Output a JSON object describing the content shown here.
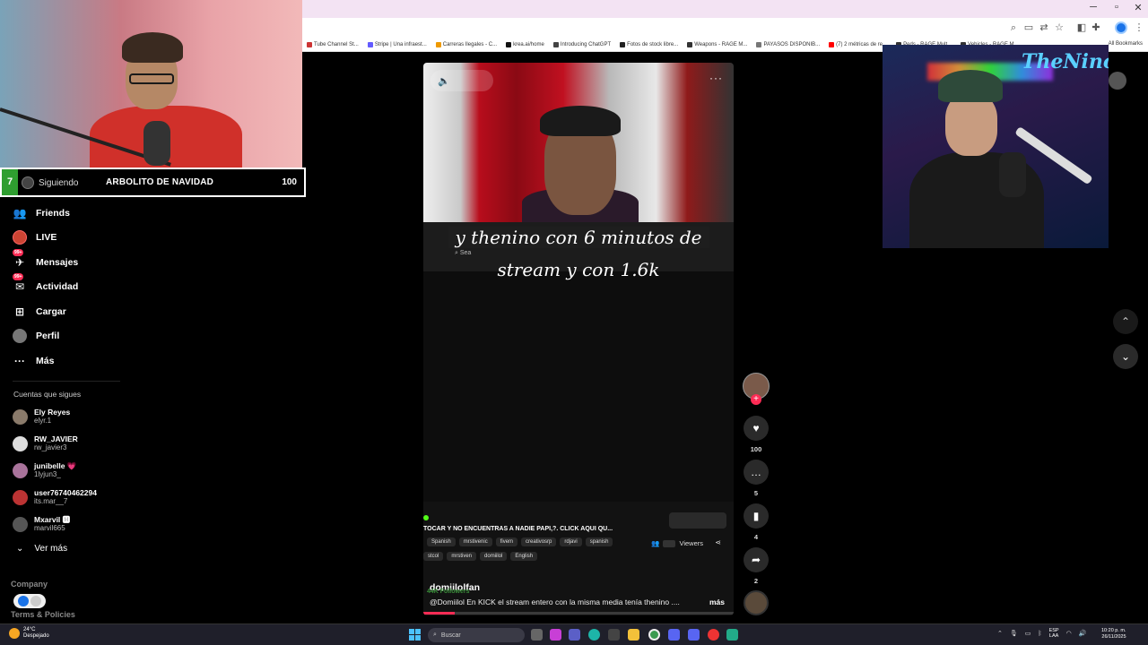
{
  "browser": {
    "bookmarks": [
      "Tube Channel St...",
      "Stripe | Una infraest...",
      "Carreras Ilegales - C...",
      "krea.ai/home",
      "Introducing ChatGPT",
      "Fotos de stock libre...",
      "Weapons - RAGE M...",
      "PAYASOS DISPONIB...",
      "(7) 2 métricas de re...",
      "Peds - RAGE Mult...",
      "Vehicles - RAGE M..."
    ],
    "all_bookmarks": "All Bookmarks"
  },
  "goal": {
    "count": "7",
    "following_label": "Siguiendo",
    "title": "ARBOLITO DE NAVIDAD",
    "number": "100"
  },
  "sidebar": {
    "items": [
      {
        "label": "Friends",
        "icon": "friends-icon"
      },
      {
        "label": "LIVE",
        "icon": "live-icon"
      },
      {
        "label": "Mensajes",
        "icon": "message-icon",
        "badge": "99+"
      },
      {
        "label": "Actividad",
        "icon": "activity-icon",
        "badge": "99+"
      },
      {
        "label": "Cargar",
        "icon": "upload-icon"
      },
      {
        "label": "Perfil",
        "icon": "profile-icon"
      },
      {
        "label": "Más",
        "icon": "more-icon"
      }
    ],
    "following_header": "Cuentas que sigues",
    "accounts": [
      {
        "name": "Ely Reyes",
        "user": "elyr.1"
      },
      {
        "name": "RW_JAVIER",
        "user": "rw_javier3"
      },
      {
        "name": "junibelle 💗",
        "user": "1lyjun3_"
      },
      {
        "name": "user76740462294",
        "user": "its.mar__7"
      },
      {
        "name": "Mxarvil 🅼",
        "user": "marvil665"
      }
    ],
    "see_more": "Ver más",
    "company": "Company",
    "terms": "Terms & Policies"
  },
  "video": {
    "caption_line1": "y thenino con 6 minutos de",
    "caption_line2": "stream y con 1.6k",
    "inner_search": "Sea",
    "stream_title": "TOCAR Y NO ENCUENTRAS A NADIE PAPI,?. CLICK AQUI QU...",
    "tags_row1": [
      "Spanish",
      "mrstivenic",
      "fivem",
      "creativosrp",
      "rdjavi",
      "spanish"
    ],
    "tags_row2": [
      "stcol",
      "mrstiven",
      "domiilol",
      "English"
    ],
    "viewers_label": "Viewers",
    "author": "domiilolfan",
    "followers": "44K Followers",
    "description": "@Domiilol En KICK el stream entero con la misma media tenía thenino ....",
    "more": "más",
    "progress": 0.1
  },
  "rail": {
    "likes": "100",
    "comments": "5",
    "saves": "4",
    "shares": "2"
  },
  "overlay": {
    "webcam2_sign": "TheNino"
  },
  "taskbar": {
    "weather_temp": "24°C",
    "weather_desc": "Despejado",
    "search": "Buscar",
    "lang1": "ESP",
    "lang2": "LAA",
    "time": "10:20 p. m.",
    "date": "26/11/2025"
  }
}
